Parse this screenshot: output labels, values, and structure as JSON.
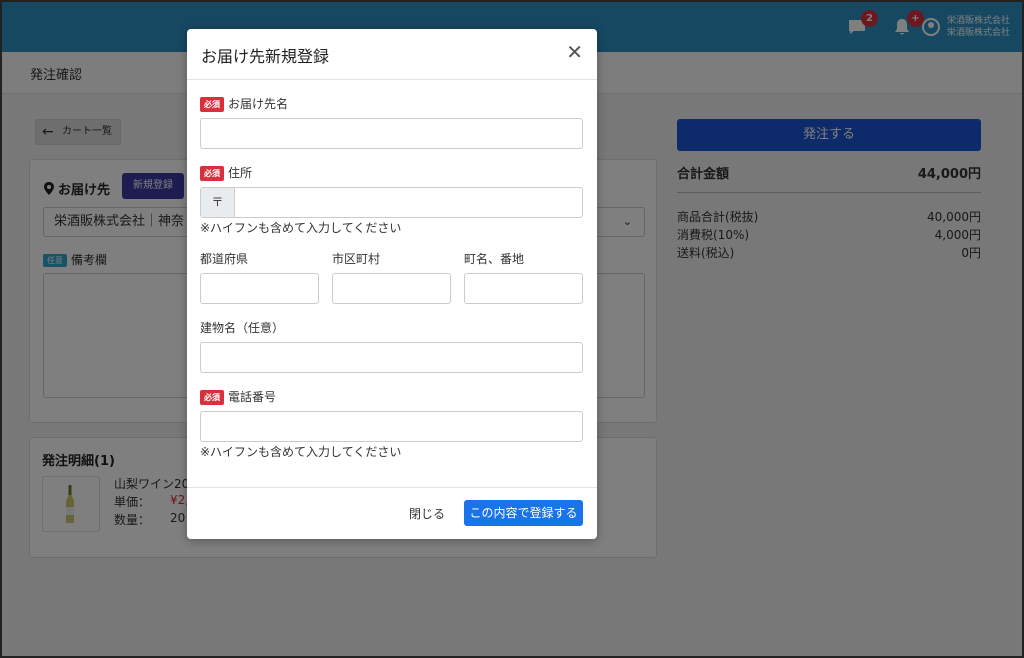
{
  "header": {
    "message_badge": "2",
    "notification_badge": "+",
    "user_line1": "栄酒販株式会社",
    "user_line2": "栄酒販株式会社"
  },
  "page": {
    "title": "発注確認"
  },
  "back_button": {
    "label": "カート一覧"
  },
  "destination": {
    "title": "お届け先",
    "new_button": "新規登録",
    "selected": "栄酒販株式会社｜神奈"
  },
  "remarks": {
    "tag": "任意",
    "label": "備考欄"
  },
  "order_detail": {
    "title": "発注明細(1)",
    "item_name": "山梨ワイン20",
    "unit_price_label": "単価：",
    "unit_price_value": "¥2,",
    "quantity_label": "数量：",
    "quantity_value": "20"
  },
  "summary": {
    "order_button": "発注する",
    "total_label": "合計金額",
    "total_value": "44,000円",
    "subtotal_label": "商品合計(税抜)",
    "subtotal_value": "40,000円",
    "tax_label": "消費税(10%)",
    "tax_value": "4,000円",
    "shipping_label": "送料(税込)",
    "shipping_value": "0円"
  },
  "modal": {
    "title": "お届け先新規登録",
    "required_tag": "必須",
    "name_label": "お届け先名",
    "address_label": "住所",
    "zip_prefix": "〒",
    "hyphen_note": "※ハイフンも含めて入力してください",
    "prefecture_label": "都道府県",
    "city_label": "市区町村",
    "town_label": "町名、番地",
    "building_label": "建物名（任意）",
    "phone_label": "電話番号",
    "phone_note": "※ハイフンも含めて入力してください",
    "close_label": "閉じる",
    "submit_label": "この内容で登録する"
  },
  "colors": {
    "header_bg": "#2e90c4",
    "primary": "#1a56d6",
    "required_badge": "#d9303e",
    "new_button": "#3c3aa5"
  }
}
